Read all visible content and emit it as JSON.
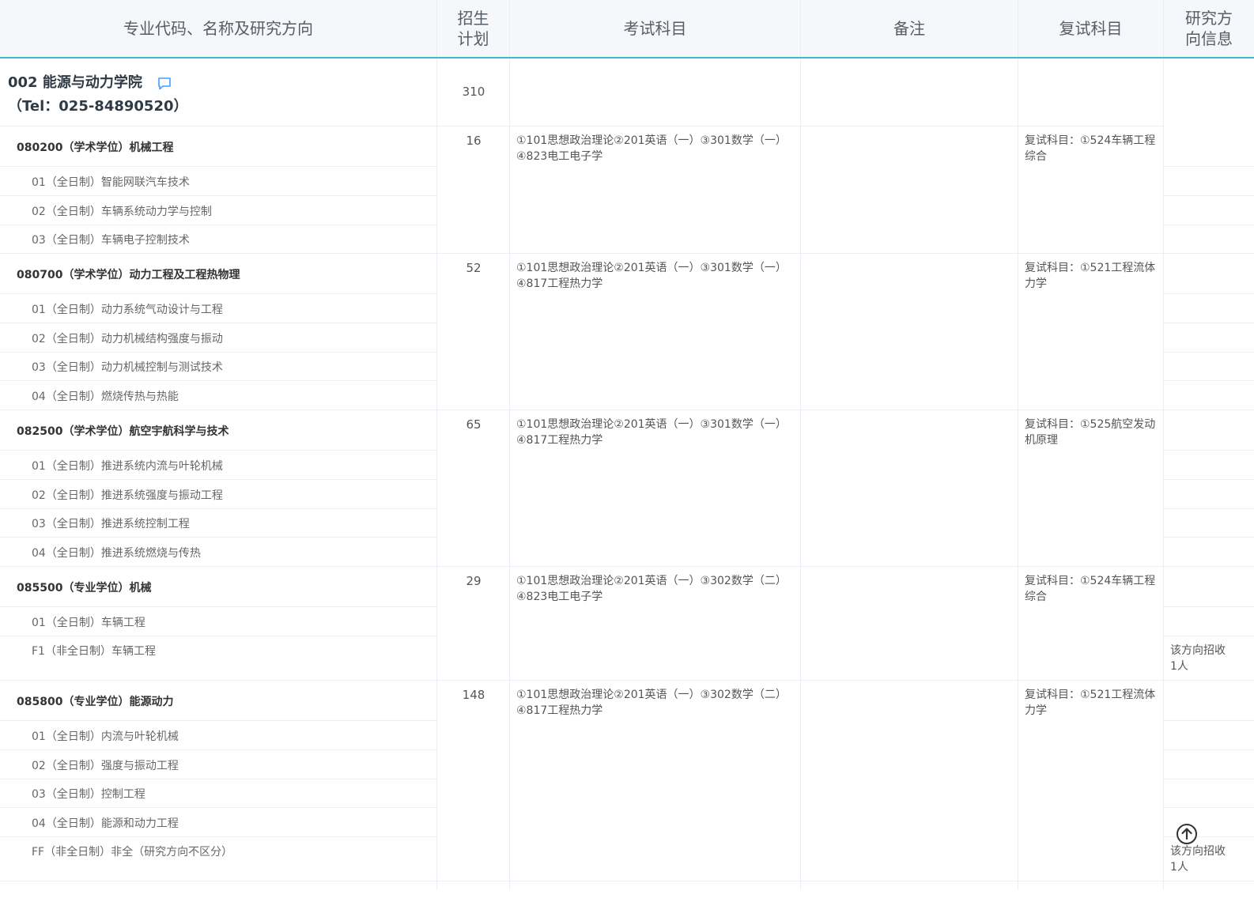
{
  "header": {
    "col_major": "专业代码、名称及研究方向",
    "col_plan_line1": "招生",
    "col_plan_line2": "计划",
    "col_exam": "考试科目",
    "col_note": "备注",
    "col_retest": "复试科目",
    "col_info_line1": "研究方",
    "col_info_line2": "向信息"
  },
  "college": {
    "name": "002 能源与动力学院",
    "tel": "（Tel：025-84890520）",
    "plan": "310"
  },
  "majors": [
    {
      "title": "080200（学术学位）机械工程",
      "plan": "16",
      "exam_line1": "①101思想政治理论②201英语（一）③301数学（一）",
      "exam_line2": "④823电工电子学",
      "retest_line1": "复试科目：①524车辆工程",
      "retest_line2": "综合",
      "directions": [
        "01（全日制）智能网联汽车技术",
        "02（全日制）车辆系统动力学与控制",
        "03（全日制）车辆电子控制技术"
      ]
    },
    {
      "title": "080700（学术学位）动力工程及工程热物理",
      "plan": "52",
      "exam_line1": "①101思想政治理论②201英语（一）③301数学（一）",
      "exam_line2": "④817工程热力学",
      "retest_line1": "复试科目：①521工程流体",
      "retest_line2": "力学",
      "directions": [
        "01（全日制）动力系统气动设计与工程",
        "02（全日制）动力机械结构强度与振动",
        "03（全日制）动力机械控制与测试技术",
        "04（全日制）燃烧传热与热能"
      ]
    },
    {
      "title": "082500（学术学位）航空宇航科学与技术",
      "plan": "65",
      "exam_line1": "①101思想政治理论②201英语（一）③301数学（一）",
      "exam_line2": "④817工程热力学",
      "retest_line1": "复试科目：①525航空发动",
      "retest_line2": "机原理",
      "directions": [
        "01（全日制）推进系统内流与叶轮机械",
        "02（全日制）推进系统强度与振动工程",
        "03（全日制）推进系统控制工程",
        "04（全日制）推进系统燃烧与传热"
      ]
    },
    {
      "title": "085500（专业学位）机械",
      "plan": "29",
      "exam_line1": "①101思想政治理论②201英语（一）③302数学（二）",
      "exam_line2": "④823电工电子学",
      "retest_line1": "复试科目：①524车辆工程",
      "retest_line2": "综合",
      "directions": [
        "01（全日制）车辆工程",
        "F1（非全日制）车辆工程"
      ],
      "info_line1": "该方向招收",
      "info_line2": "1人"
    },
    {
      "title": "085800（专业学位）能源动力",
      "plan": "148",
      "exam_line1": "①101思想政治理论②201英语（一）③302数学（二）",
      "exam_line2": "④817工程热力学",
      "retest_line1": "复试科目：①521工程流体",
      "retest_line2": "力学",
      "directions": [
        "01（全日制）内流与叶轮机械",
        "02（全日制）强度与振动工程",
        "03（全日制）控制工程",
        "04（全日制）能源和动力工程",
        "FF（非全日制）非全（研究方向不区分）"
      ],
      "info_line1": "该方向招收",
      "info_line2": "1人"
    }
  ],
  "icons": {
    "chat": "chat-bubble-icon",
    "back_to_top": "arrow-up-circle-icon"
  },
  "colors": {
    "header_bg": "#f5f7fa",
    "header_accent": "#3eb8d3",
    "chat_icon": "#409eff",
    "border": "#ebeef5"
  }
}
